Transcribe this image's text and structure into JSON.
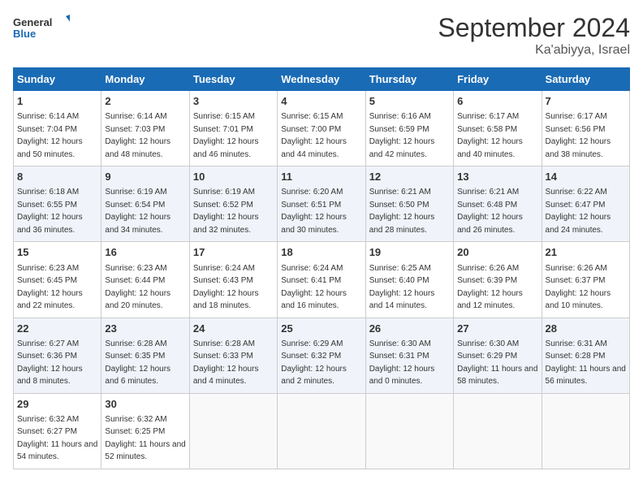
{
  "header": {
    "logo_general": "General",
    "logo_blue": "Blue",
    "month_year": "September 2024",
    "location": "Ka'abiyya, Israel"
  },
  "days_of_week": [
    "Sunday",
    "Monday",
    "Tuesday",
    "Wednesday",
    "Thursday",
    "Friday",
    "Saturday"
  ],
  "weeks": [
    [
      {
        "day": "1",
        "sunrise": "Sunrise: 6:14 AM",
        "sunset": "Sunset: 7:04 PM",
        "daylight": "Daylight: 12 hours and 50 minutes."
      },
      {
        "day": "2",
        "sunrise": "Sunrise: 6:14 AM",
        "sunset": "Sunset: 7:03 PM",
        "daylight": "Daylight: 12 hours and 48 minutes."
      },
      {
        "day": "3",
        "sunrise": "Sunrise: 6:15 AM",
        "sunset": "Sunset: 7:01 PM",
        "daylight": "Daylight: 12 hours and 46 minutes."
      },
      {
        "day": "4",
        "sunrise": "Sunrise: 6:15 AM",
        "sunset": "Sunset: 7:00 PM",
        "daylight": "Daylight: 12 hours and 44 minutes."
      },
      {
        "day": "5",
        "sunrise": "Sunrise: 6:16 AM",
        "sunset": "Sunset: 6:59 PM",
        "daylight": "Daylight: 12 hours and 42 minutes."
      },
      {
        "day": "6",
        "sunrise": "Sunrise: 6:17 AM",
        "sunset": "Sunset: 6:58 PM",
        "daylight": "Daylight: 12 hours and 40 minutes."
      },
      {
        "day": "7",
        "sunrise": "Sunrise: 6:17 AM",
        "sunset": "Sunset: 6:56 PM",
        "daylight": "Daylight: 12 hours and 38 minutes."
      }
    ],
    [
      {
        "day": "8",
        "sunrise": "Sunrise: 6:18 AM",
        "sunset": "Sunset: 6:55 PM",
        "daylight": "Daylight: 12 hours and 36 minutes."
      },
      {
        "day": "9",
        "sunrise": "Sunrise: 6:19 AM",
        "sunset": "Sunset: 6:54 PM",
        "daylight": "Daylight: 12 hours and 34 minutes."
      },
      {
        "day": "10",
        "sunrise": "Sunrise: 6:19 AM",
        "sunset": "Sunset: 6:52 PM",
        "daylight": "Daylight: 12 hours and 32 minutes."
      },
      {
        "day": "11",
        "sunrise": "Sunrise: 6:20 AM",
        "sunset": "Sunset: 6:51 PM",
        "daylight": "Daylight: 12 hours and 30 minutes."
      },
      {
        "day": "12",
        "sunrise": "Sunrise: 6:21 AM",
        "sunset": "Sunset: 6:50 PM",
        "daylight": "Daylight: 12 hours and 28 minutes."
      },
      {
        "day": "13",
        "sunrise": "Sunrise: 6:21 AM",
        "sunset": "Sunset: 6:48 PM",
        "daylight": "Daylight: 12 hours and 26 minutes."
      },
      {
        "day": "14",
        "sunrise": "Sunrise: 6:22 AM",
        "sunset": "Sunset: 6:47 PM",
        "daylight": "Daylight: 12 hours and 24 minutes."
      }
    ],
    [
      {
        "day": "15",
        "sunrise": "Sunrise: 6:23 AM",
        "sunset": "Sunset: 6:45 PM",
        "daylight": "Daylight: 12 hours and 22 minutes."
      },
      {
        "day": "16",
        "sunrise": "Sunrise: 6:23 AM",
        "sunset": "Sunset: 6:44 PM",
        "daylight": "Daylight: 12 hours and 20 minutes."
      },
      {
        "day": "17",
        "sunrise": "Sunrise: 6:24 AM",
        "sunset": "Sunset: 6:43 PM",
        "daylight": "Daylight: 12 hours and 18 minutes."
      },
      {
        "day": "18",
        "sunrise": "Sunrise: 6:24 AM",
        "sunset": "Sunset: 6:41 PM",
        "daylight": "Daylight: 12 hours and 16 minutes."
      },
      {
        "day": "19",
        "sunrise": "Sunrise: 6:25 AM",
        "sunset": "Sunset: 6:40 PM",
        "daylight": "Daylight: 12 hours and 14 minutes."
      },
      {
        "day": "20",
        "sunrise": "Sunrise: 6:26 AM",
        "sunset": "Sunset: 6:39 PM",
        "daylight": "Daylight: 12 hours and 12 minutes."
      },
      {
        "day": "21",
        "sunrise": "Sunrise: 6:26 AM",
        "sunset": "Sunset: 6:37 PM",
        "daylight": "Daylight: 12 hours and 10 minutes."
      }
    ],
    [
      {
        "day": "22",
        "sunrise": "Sunrise: 6:27 AM",
        "sunset": "Sunset: 6:36 PM",
        "daylight": "Daylight: 12 hours and 8 minutes."
      },
      {
        "day": "23",
        "sunrise": "Sunrise: 6:28 AM",
        "sunset": "Sunset: 6:35 PM",
        "daylight": "Daylight: 12 hours and 6 minutes."
      },
      {
        "day": "24",
        "sunrise": "Sunrise: 6:28 AM",
        "sunset": "Sunset: 6:33 PM",
        "daylight": "Daylight: 12 hours and 4 minutes."
      },
      {
        "day": "25",
        "sunrise": "Sunrise: 6:29 AM",
        "sunset": "Sunset: 6:32 PM",
        "daylight": "Daylight: 12 hours and 2 minutes."
      },
      {
        "day": "26",
        "sunrise": "Sunrise: 6:30 AM",
        "sunset": "Sunset: 6:31 PM",
        "daylight": "Daylight: 12 hours and 0 minutes."
      },
      {
        "day": "27",
        "sunrise": "Sunrise: 6:30 AM",
        "sunset": "Sunset: 6:29 PM",
        "daylight": "Daylight: 11 hours and 58 minutes."
      },
      {
        "day": "28",
        "sunrise": "Sunrise: 6:31 AM",
        "sunset": "Sunset: 6:28 PM",
        "daylight": "Daylight: 11 hours and 56 minutes."
      }
    ],
    [
      {
        "day": "29",
        "sunrise": "Sunrise: 6:32 AM",
        "sunset": "Sunset: 6:27 PM",
        "daylight": "Daylight: 11 hours and 54 minutes."
      },
      {
        "day": "30",
        "sunrise": "Sunrise: 6:32 AM",
        "sunset": "Sunset: 6:25 PM",
        "daylight": "Daylight: 11 hours and 52 minutes."
      },
      null,
      null,
      null,
      null,
      null
    ]
  ]
}
